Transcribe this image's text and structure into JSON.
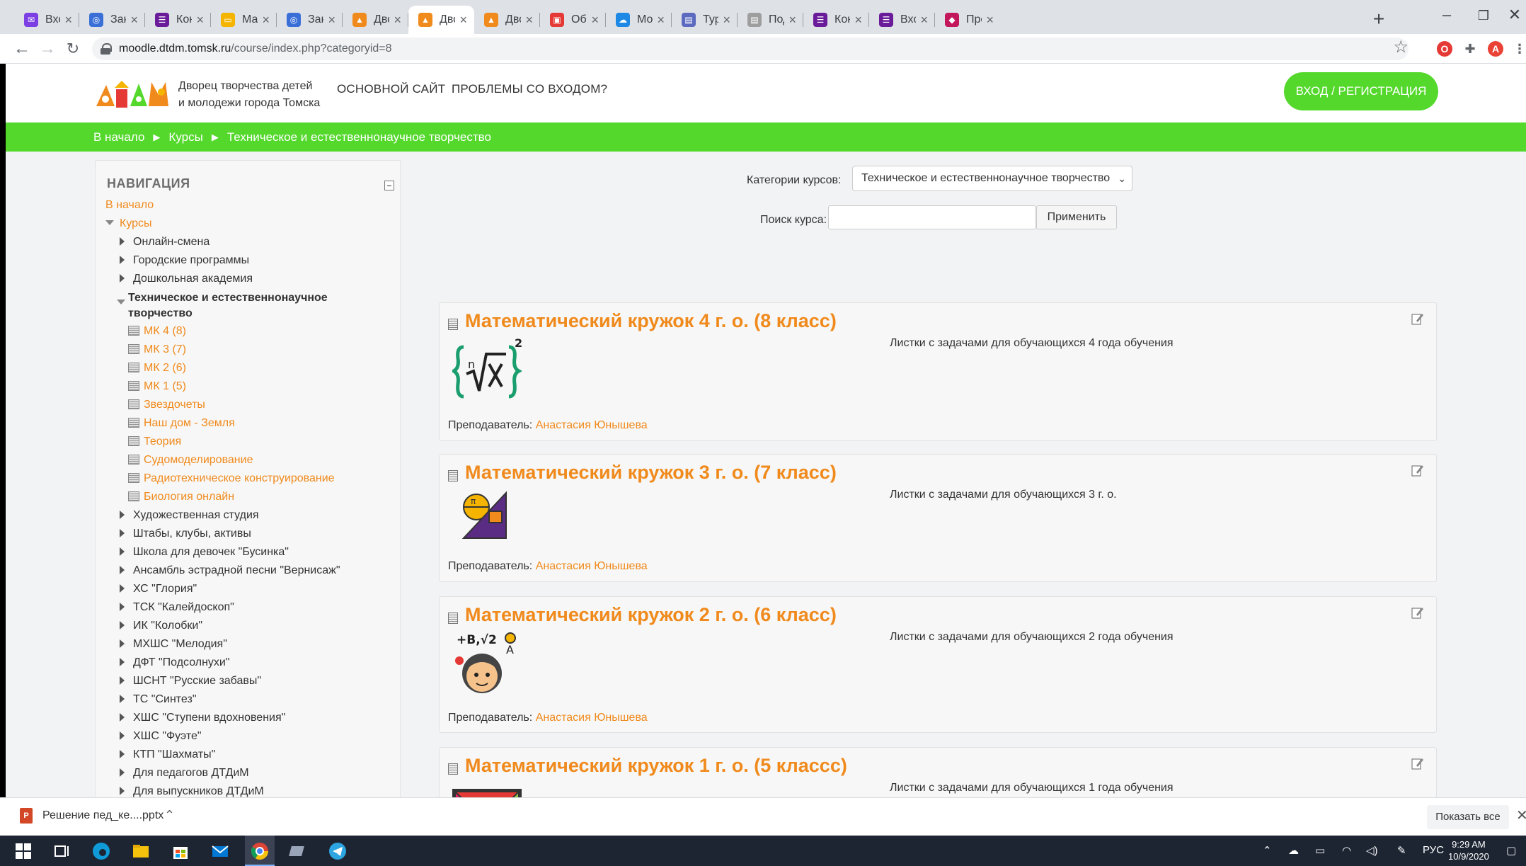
{
  "browser": {
    "tabs": [
      {
        "label": "Входящи",
        "favicon_color": "#7b3fe4",
        "favicon_glyph": "mail-icon"
      },
      {
        "label": "Заказ №",
        "favicon_color": "#3b6fd8",
        "favicon_glyph": "globe-icon"
      },
      {
        "label": "Контакт",
        "favicon_color": "#6a1b9a",
        "favicon_glyph": "form-icon"
      },
      {
        "label": "Математ",
        "favicon_color": "#f4b400",
        "favicon_glyph": "slides-icon"
      },
      {
        "label": "Заказ №",
        "favicon_color": "#3b6fd8",
        "favicon_glyph": "globe-icon"
      },
      {
        "label": "Дворец",
        "favicon_color": "#f08a1c",
        "favicon_glyph": "moodle-icon"
      },
      {
        "label": "Дворец",
        "favicon_color": "#f08a1c",
        "favicon_glyph": "moodle-icon"
      },
      {
        "label": "Дворец",
        "favicon_color": "#f08a1c",
        "favicon_glyph": "moodle-icon"
      },
      {
        "label": "Образо",
        "favicon_color": "#e53935",
        "favicon_glyph": "image-icon"
      },
      {
        "label": "Мои фа",
        "favicon_color": "#1e88e5",
        "favicon_glyph": "cloud-icon"
      },
      {
        "label": "Турнир",
        "favicon_color": "#5c6bc0",
        "favicon_glyph": "doc-icon"
      },
      {
        "label": "Подача",
        "favicon_color": "#9e9e9e",
        "favicon_glyph": "doc-icon"
      },
      {
        "label": "Контакт",
        "favicon_color": "#6a1b9a",
        "favicon_glyph": "form-icon"
      },
      {
        "label": "Входная",
        "favicon_color": "#6a1b9a",
        "favicon_glyph": "form-icon"
      },
      {
        "label": "Презент",
        "favicon_color": "#c2185b",
        "favicon_glyph": "present-icon"
      }
    ],
    "active_tab_index": 6,
    "url_domain": "moodle.dtdm.tomsk.ru",
    "url_path": "/course/index.php?categoryid=8",
    "profile_initial": "A"
  },
  "header": {
    "org_name_line1": "Дворец творчества детей",
    "org_name_line2": "и молодежи города Томска",
    "nav_main_site": "Основной сайт",
    "nav_login_problems": "Проблемы со входом?",
    "login_button": "Вход / Регистрация"
  },
  "breadcrumb": {
    "home": "В начало",
    "courses": "Курсы",
    "current": "Техническое и естественнонаучное творчество"
  },
  "sidebar": {
    "title": "НАВИГАЦИЯ",
    "home": "В начало",
    "courses": "Курсы",
    "categories_before": [
      "Онлайн-смена",
      "Городские программы",
      "Дошкольная академия"
    ],
    "current_category_line1": "Техническое и естественнонаучное",
    "current_category_line2": "творчество",
    "courses_in_category": [
      "МК 4 (8)",
      "МК 3 (7)",
      "МК 2 (6)",
      "МК 1 (5)",
      "Звездочеты",
      "Наш дом - Земля",
      "Теория",
      "Судомоделирование",
      "Радиотехническое конструирование",
      "Биология онлайн"
    ],
    "categories_after": [
      "Художественная студия",
      "Штабы, клубы, активы",
      "Школа для девочек \"Бусинка\"",
      "Ансамбль эстрадной песни \"Вернисаж\"",
      "ХС \"Глория\"",
      "ТСК \"Калейдоскоп\"",
      "ИК \"Колобки\"",
      "МХШС \"Мелодия\"",
      "ДФТ \"Подсолнухи\"",
      "ШСНТ \"Русские забавы\"",
      "ТС \"Синтез\"",
      "ХШС \"Ступени вдохновения\"",
      "ХШС \"Фуэте\"",
      "КТП \"Шахматы\"",
      "Для педагогов ДТДиМ",
      "Для выпускников ДТДиМ"
    ]
  },
  "main": {
    "categories_label": "Категории курсов:",
    "category_selected": "Техническое и естественнонаучное творчество",
    "search_label": "Поиск курса:",
    "search_value": "",
    "apply_button": "Применить",
    "teacher_label": "Преподаватель:",
    "courses": [
      {
        "title": "Математический кружок 4 г. о. (8 класс)",
        "summary": "Листки с задачами для обучающихся 4 года обучения",
        "teacher": "Анастасия Юнышева"
      },
      {
        "title": "Математический кружок 3 г. о. (7 класс)",
        "summary": "Листки с задачами для обучающихся 3 г. о.",
        "teacher": "Анастасия Юнышева"
      },
      {
        "title": "Математический кружок 2 г. о. (6 класс)",
        "summary": "Листки с задачами для обучающихся 2 года обучения",
        "teacher": "Анастасия Юнышева"
      },
      {
        "title": "Математический кружок 1 г. о. (5 классс)",
        "summary": "Листки с задачами для обучающихся 1 года обучения",
        "teacher": ""
      }
    ]
  },
  "downloads": {
    "file_name": "Решение пед_ке....pptx",
    "show_all": "Показать все"
  },
  "taskbar": {
    "language": "РУС",
    "time": "9:29 AM",
    "date": "10/9/2020"
  },
  "colors": {
    "accent_green": "#53d82b",
    "link_orange": "#f08a1c"
  }
}
